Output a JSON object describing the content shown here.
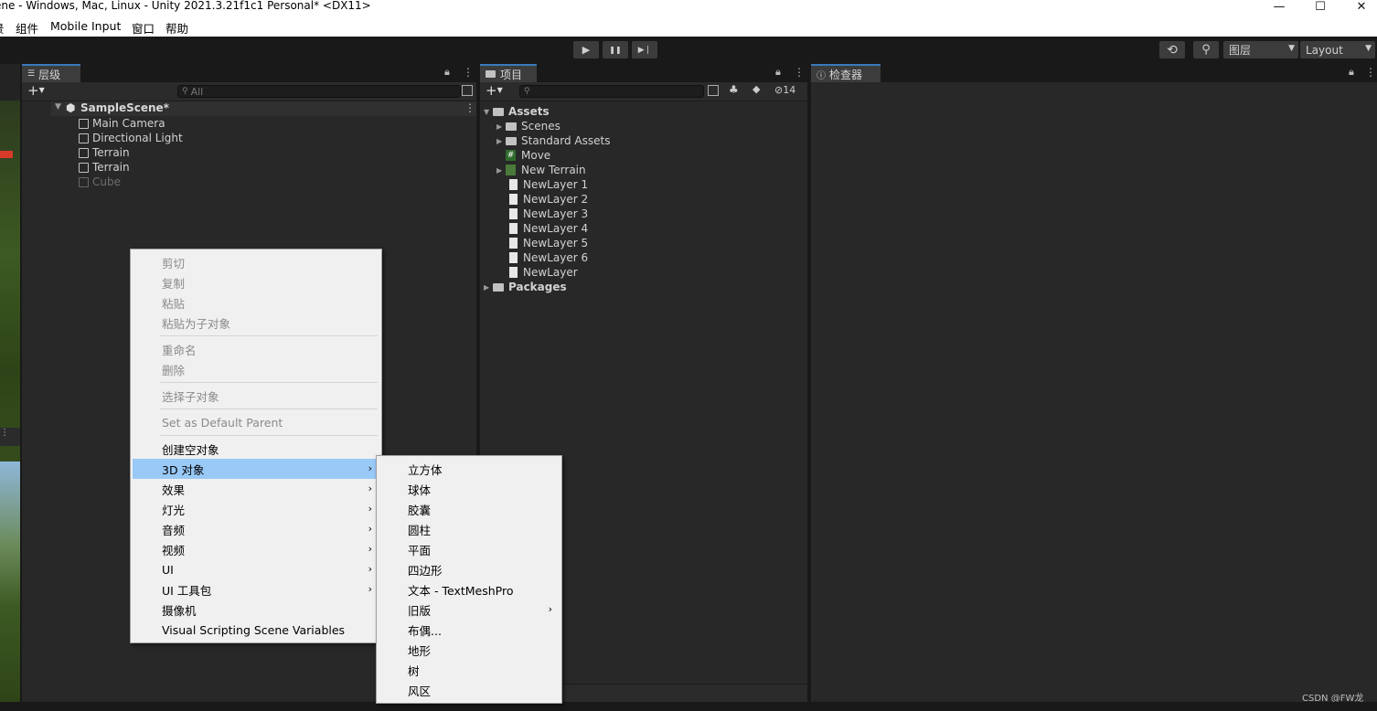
{
  "window": {
    "title": "ene - Windows, Mac, Linux - Unity 2021.3.21f1c1 Personal* <DX11>",
    "controls": [
      "—",
      "☐",
      "✕"
    ]
  },
  "menubar": {
    "items": [
      "景",
      "组件",
      "Mobile Input",
      "窗口",
      "帮助"
    ]
  },
  "toolbar": {
    "play": "▶",
    "pause": "❚❚",
    "step": "▶❘",
    "history": "⟲",
    "search": "⚲",
    "layers_label": "图层",
    "layout_label": "Layout"
  },
  "hierarchy": {
    "tab_label": "层级",
    "search_placeholder": "All",
    "scene": "SampleScene*",
    "items": [
      {
        "label": "Main Camera"
      },
      {
        "label": "Directional Light"
      },
      {
        "label": "Terrain"
      },
      {
        "label": "Terrain"
      },
      {
        "label": "Cube"
      }
    ]
  },
  "project": {
    "tab_label": "项目",
    "hidden_count": "14",
    "root": "Assets",
    "items": [
      {
        "label": "Scenes"
      },
      {
        "label": "Standard Assets"
      },
      {
        "label": "Move"
      },
      {
        "label": "New Terrain"
      },
      {
        "label": "NewLayer 1"
      },
      {
        "label": "NewLayer 2"
      },
      {
        "label": "NewLayer 3"
      },
      {
        "label": "NewLayer 4"
      },
      {
        "label": "NewLayer 5"
      },
      {
        "label": "NewLayer 6"
      },
      {
        "label": "NewLayer"
      }
    ],
    "packages": "Packages"
  },
  "inspector": {
    "tab_label": "检查器"
  },
  "context_menu": {
    "items": [
      {
        "label": "剪切"
      },
      {
        "label": "复制"
      },
      {
        "label": "粘贴"
      },
      {
        "label": "粘贴为子对象"
      },
      {
        "label": "重命名"
      },
      {
        "label": "删除"
      },
      {
        "label": "选择子对象"
      },
      {
        "label": "Set as Default Parent"
      },
      {
        "label": "创建空对象"
      },
      {
        "label": "3D 对象"
      },
      {
        "label": "效果"
      },
      {
        "label": "灯光"
      },
      {
        "label": "音频"
      },
      {
        "label": "视频"
      },
      {
        "label": "UI"
      },
      {
        "label": "UI 工具包"
      },
      {
        "label": "摄像机"
      },
      {
        "label": "Visual Scripting Scene Variables"
      }
    ],
    "submenu_arrow": "›"
  },
  "submenu_3d": {
    "items": [
      {
        "label": "立方体"
      },
      {
        "label": "球体"
      },
      {
        "label": "胶囊"
      },
      {
        "label": "圆柱"
      },
      {
        "label": "平面"
      },
      {
        "label": "四边形"
      },
      {
        "label": "文本 - TextMeshPro"
      },
      {
        "label": "旧版"
      },
      {
        "label": "布偶..."
      },
      {
        "label": "地形"
      },
      {
        "label": "树"
      },
      {
        "label": "风区"
      }
    ]
  },
  "watermark": "CSDN @FW龙",
  "colors": {
    "highlight": "#99c9f7",
    "panel_bg": "#282828",
    "tab_accent": "#3a79bb"
  }
}
